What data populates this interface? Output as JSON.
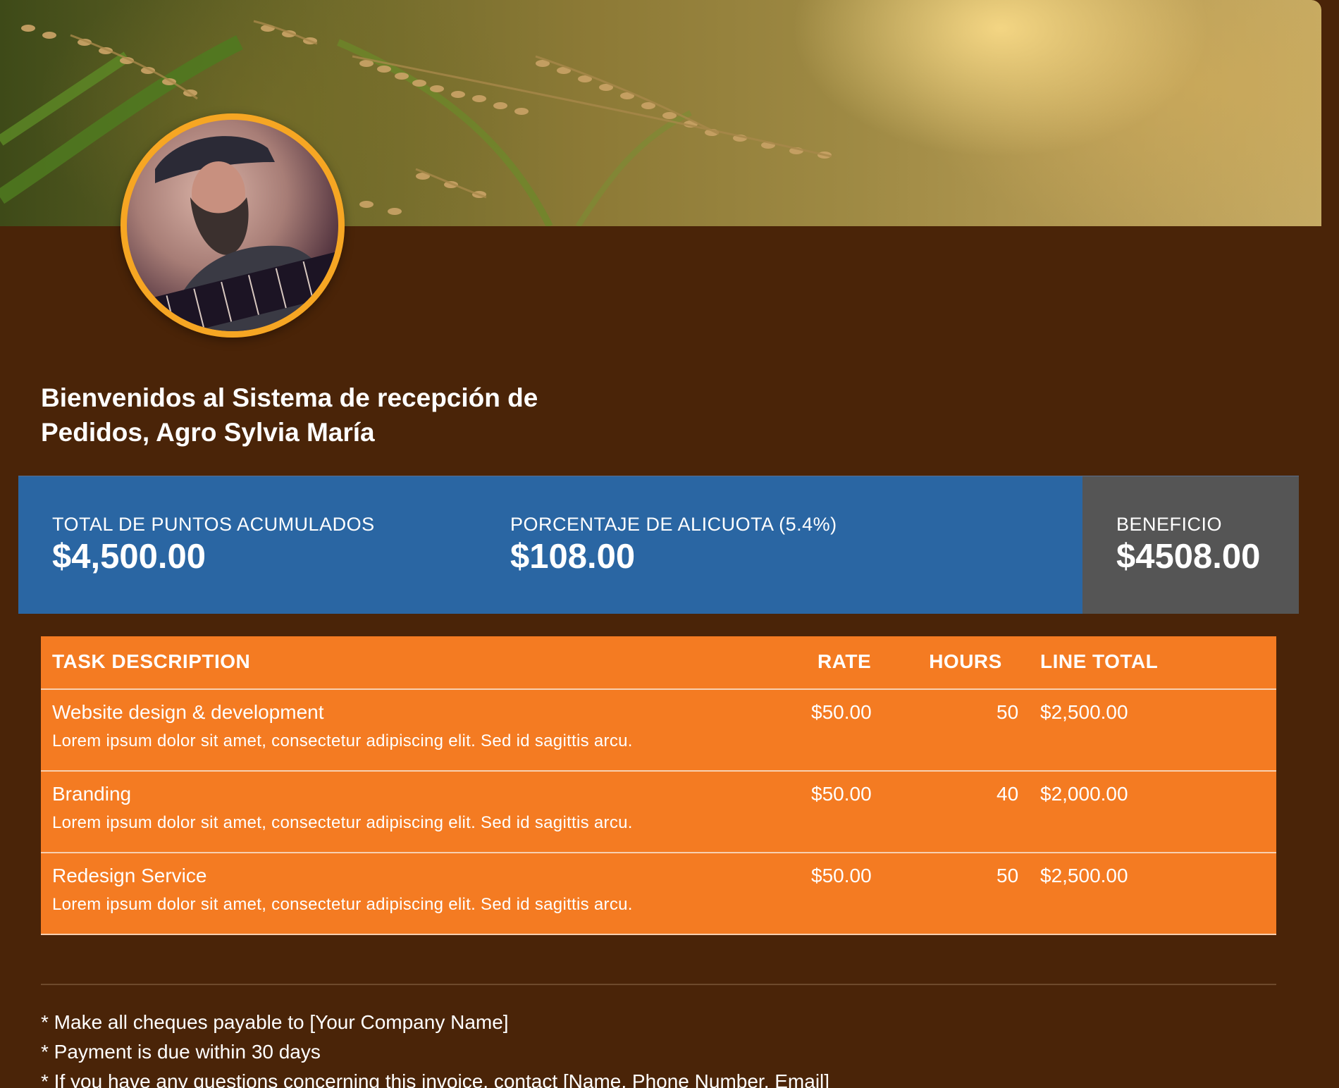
{
  "header": {
    "banner_alt": "rice field banner",
    "avatar_alt": "profile avatar"
  },
  "welcome": {
    "line1": "Bienvenidos al Sistema de recepción de",
    "line2": "Pedidos, Agro Sylvia María"
  },
  "summary": {
    "stats": [
      {
        "label": "TOTAL DE PUNTOS ACUMULADOS",
        "value": "$4,500.00"
      },
      {
        "label": "PORCENTAJE DE ALICUOTA (5.4%)",
        "value": "$108.00"
      },
      {
        "label": "BENEFICIO",
        "value": "$4508.00"
      }
    ],
    "colors": {
      "main": "#2a66a3",
      "side": "#555555"
    }
  },
  "table": {
    "headers": {
      "description": "TASK DESCRIPTION",
      "rate": "RATE",
      "hours": "HOURS",
      "total": "LINE TOTAL"
    },
    "rows": [
      {
        "title": "Website design & development",
        "sub": "Lorem ipsum dolor sit amet, consectetur adipiscing elit. Sed id sagittis arcu.",
        "rate": "$50.00",
        "hours": "50",
        "total": "$2,500.00"
      },
      {
        "title": "Branding",
        "sub": "Lorem ipsum dolor sit amet, consectetur adipiscing elit. Sed id sagittis arcu.",
        "rate": "$50.00",
        "hours": "40",
        "total": "$2,000.00"
      },
      {
        "title": "Redesign Service",
        "sub": "Lorem ipsum dolor sit amet, consectetur adipiscing elit. Sed id sagittis arcu.",
        "rate": "$50.00",
        "hours": "50",
        "total": "$2,500.00"
      }
    ],
    "color": "#f47b22"
  },
  "notes": [
    "* Make all cheques payable to [Your Company Name]",
    "* Payment is due within 30 days",
    "* If you have any questions concerning this invoice, contact [Name, Phone Number, Email]"
  ],
  "colors": {
    "background": "#4a2408",
    "avatar_ring": "#f6a623"
  }
}
